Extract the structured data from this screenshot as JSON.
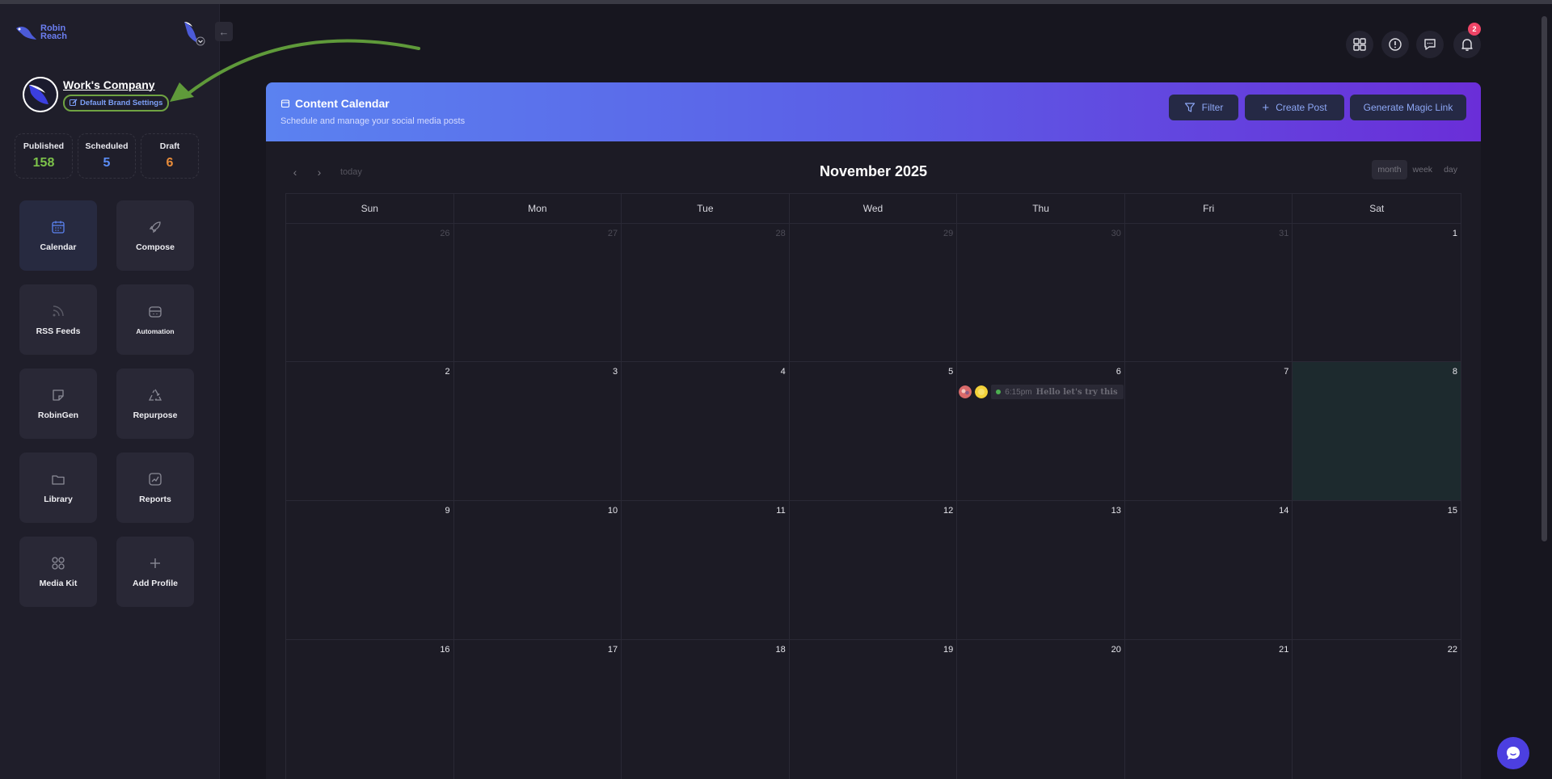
{
  "app": {
    "logo_line1": "Robin",
    "logo_line2": "Reach",
    "collapse_icon": "arrow-left-icon"
  },
  "company": {
    "name": "Work's Company",
    "settings_label": "Default Brand Settings"
  },
  "stats": [
    {
      "label": "Published",
      "value": "158",
      "color": "#7cc24a"
    },
    {
      "label": "Scheduled",
      "value": "5",
      "color": "#5b8df5"
    },
    {
      "label": "Draft",
      "value": "6",
      "color": "#e88c3a"
    }
  ],
  "tiles": [
    {
      "label": "Calendar",
      "icon": "calendar-icon"
    },
    {
      "label": "Compose",
      "icon": "rocket-icon"
    },
    {
      "label": "RSS Feeds",
      "icon": "rss-icon"
    },
    {
      "label": "Automation",
      "icon": "bot-icon"
    },
    {
      "label": "RobinGen",
      "icon": "note-icon"
    },
    {
      "label": "Repurpose",
      "icon": "recycle-icon"
    },
    {
      "label": "Library",
      "icon": "folder-icon"
    },
    {
      "label": "Reports",
      "icon": "chart-icon"
    },
    {
      "label": "Media Kit",
      "icon": "grid-circles-icon"
    },
    {
      "label": "Add Profile",
      "icon": "plus-icon"
    }
  ],
  "header_icons": {
    "apps": "apps-grid-icon",
    "alert": "alert-circle-icon",
    "chat": "chat-icon",
    "bell": "bell-icon",
    "notification_count": "2"
  },
  "panel": {
    "title": "Content Calendar",
    "subtitle": "Schedule and manage your social media posts",
    "filter_label": "Filter",
    "create_label": "Create Post",
    "magic_label": "Generate Magic Link"
  },
  "calendar": {
    "title": "November 2025",
    "today_label": "today",
    "views": [
      "month",
      "week",
      "day"
    ],
    "active_view": "month",
    "weekdays": [
      "Sun",
      "Mon",
      "Tue",
      "Wed",
      "Thu",
      "Fri",
      "Sat"
    ],
    "weeks": [
      [
        "26",
        "27",
        "28",
        "29",
        "30",
        "31",
        "1"
      ],
      [
        "2",
        "3",
        "4",
        "5",
        "6",
        "7",
        "8"
      ],
      [
        "9",
        "10",
        "11",
        "12",
        "13",
        "14",
        "15"
      ],
      [
        "16",
        "17",
        "18",
        "19",
        "20",
        "21",
        "22"
      ]
    ],
    "event": {
      "time": "6:15pm",
      "text": "Hello let's try this",
      "status_color": "#4caf50"
    },
    "accent_color": "#5b82f0"
  }
}
